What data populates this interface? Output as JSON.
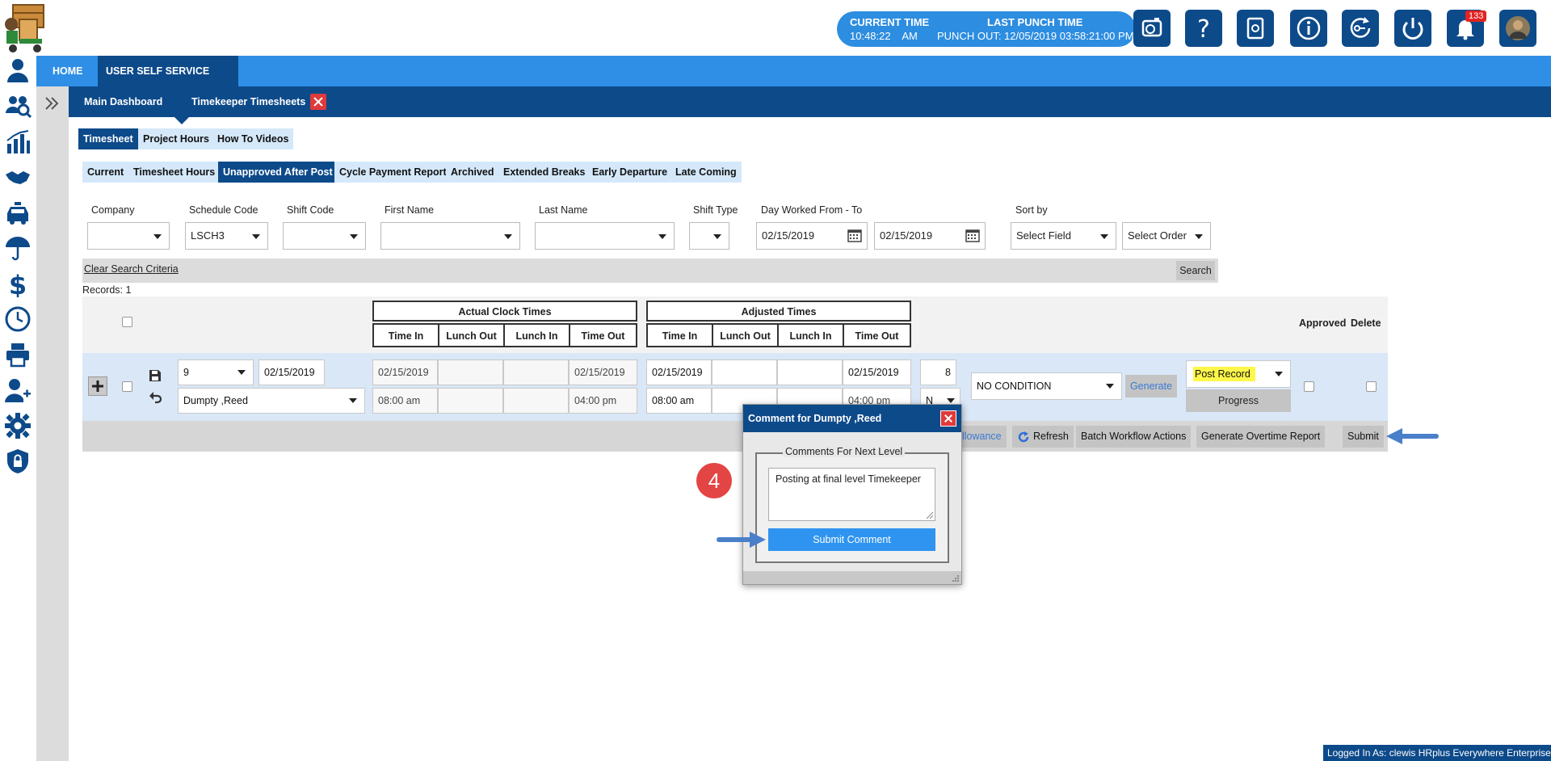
{
  "header": {
    "current_time_label": "CURRENT TIME",
    "current_time_value": "10:48:22    AM",
    "last_punch_label": "LAST PUNCH TIME",
    "last_punch_value": "PUNCH OUT: 12/05/2019 03:58:21:00 PM",
    "notification_count": "133"
  },
  "top_tabs": {
    "home": "HOME",
    "self_service": "USER SELF SERVICE"
  },
  "sub_tabs": {
    "dashboard": "Main Dashboard",
    "timesheets": "Timekeeper Timesheets"
  },
  "view_tabs": [
    "Timesheet",
    "Project Hours",
    "How To Videos"
  ],
  "report_tabs": [
    "Current",
    "Timesheet Hours",
    "Unapproved After Post",
    "Cycle Payment Report",
    "Archived",
    "Extended Breaks",
    "Early Departure",
    "Late Coming"
  ],
  "filters": {
    "company_label": "Company",
    "schedule_label": "Schedule Code",
    "schedule_value": "LSCH3",
    "shift_code_label": "Shift Code",
    "first_name_label": "First Name",
    "last_name_label": "Last Name",
    "shift_type_label": "Shift Type",
    "day_worked_label": "Day Worked From - To",
    "date_from": "02/15/2019",
    "date_to": "02/15/2019",
    "sort_label": "Sort by",
    "sort_field": "Select Field",
    "sort_order": "Select Order"
  },
  "search": {
    "clear": "Clear Search Criteria",
    "button": "Search"
  },
  "records_label": "Records:  1",
  "grid": {
    "actual_header": "Actual Clock Times",
    "adjusted_header": "Adjusted Times",
    "columns": [
      "Time In",
      "Lunch Out",
      "Lunch In",
      "Time Out"
    ],
    "approved": "Approved",
    "delete": "Delete",
    "row": {
      "shift_value": "9",
      "date_value": "02/15/2019",
      "employee": "Dumpty ,Reed",
      "actual_date_in": "02/15/2019",
      "actual_date_out": "02/15/2019",
      "actual_time_in": "08:00 am",
      "actual_time_out": "04:00 pm",
      "adj_date_in": "02/15/2019",
      "adj_date_out": "02/15/2019",
      "adj_time_in": "08:00 am",
      "adj_time_out": "04:00 pm",
      "hours": "8",
      "flag": "N",
      "condition": "NO CONDITION",
      "generate": "Generate",
      "action": "Post Record",
      "progress": "Progress"
    }
  },
  "footer_actions": {
    "allowance": "llowance",
    "refresh": "Refresh",
    "batch": "Batch Workflow Actions",
    "overtime": "Generate Overtime Report",
    "submit": "Submit"
  },
  "modal": {
    "title": "Comment for Dumpty ,Reed",
    "legend": "Comments For Next Level",
    "comment": "Posting at final level Timekeeper",
    "submit": "Submit Comment"
  },
  "step_number": "4",
  "logged_in": "Logged In As: clewis HRplus Everywhere Enterprise"
}
